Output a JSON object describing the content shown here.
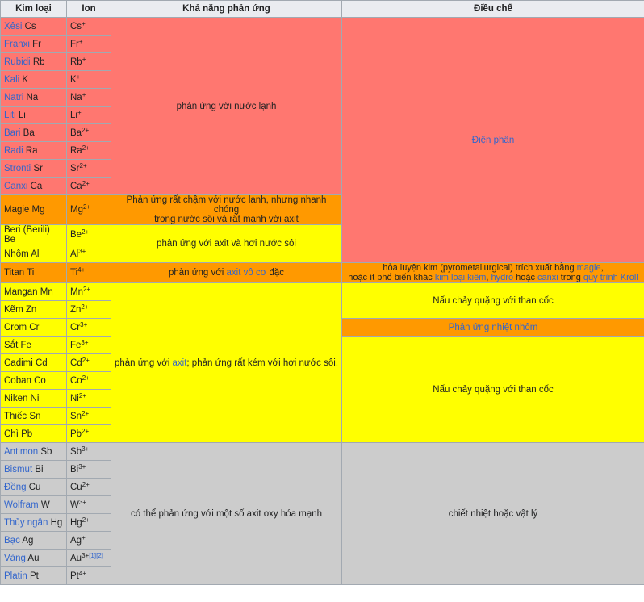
{
  "headers": {
    "metal": "Kim loại",
    "ion": "Ion",
    "reactivity": "Khả năng phản ứng",
    "extraction": "Điều chế"
  },
  "colors": {
    "red": "#ff7770",
    "orange": "#ff9900",
    "yellow": "#ffff00",
    "gray": "#cccccc",
    "link": "#3366cc"
  },
  "rows": [
    {
      "link": "Xêsi",
      "symbol": "Cs",
      "ion_base": "Cs",
      "ion_sup": "+"
    },
    {
      "link": "Franxi",
      "symbol": "Fr",
      "ion_base": "Fr",
      "ion_sup": "+"
    },
    {
      "link": "Rubidi",
      "symbol": "Rb",
      "ion_base": "Rb",
      "ion_sup": "+"
    },
    {
      "link": "Kali",
      "symbol": "K",
      "ion_base": "K",
      "ion_sup": "+"
    },
    {
      "link": "Natri",
      "symbol": "Na",
      "ion_base": "Na",
      "ion_sup": "+"
    },
    {
      "link": "Liti",
      "symbol": "Li",
      "ion_base": "Li",
      "ion_sup": "+"
    },
    {
      "link": "Bari",
      "symbol": "Ba",
      "ion_base": "Ba",
      "ion_sup": "2+"
    },
    {
      "link": "Radi",
      "symbol": "Ra",
      "ion_base": "Ra",
      "ion_sup": "2+"
    },
    {
      "link": "Stronti",
      "symbol": "Sr",
      "ion_base": "Sr",
      "ion_sup": "2+"
    },
    {
      "link": "Canxi",
      "symbol": "Ca",
      "ion_base": "Ca",
      "ion_sup": "2+"
    },
    {
      "text": "Magie Mg",
      "ion_base": "Mg",
      "ion_sup": "2+"
    },
    {
      "text": "Beri (Berili) Be",
      "ion_base": "Be",
      "ion_sup": "2+"
    },
    {
      "text": "Nhôm Al",
      "ion_base": "Al",
      "ion_sup": "3+"
    },
    {
      "text": "Titan Ti",
      "ion_base": "Ti",
      "ion_sup": "4+"
    },
    {
      "text": "Mangan Mn",
      "ion_base": "Mn",
      "ion_sup": "2+"
    },
    {
      "text": "Kẽm Zn",
      "ion_base": "Zn",
      "ion_sup": "2+"
    },
    {
      "text": "Crom Cr",
      "ion_base": "Cr",
      "ion_sup": "3+"
    },
    {
      "text": "Sắt Fe",
      "ion_base": "Fe",
      "ion_sup": "3+"
    },
    {
      "text": "Cadimi Cd",
      "ion_base": "Cd",
      "ion_sup": "2+"
    },
    {
      "text": "Coban Co",
      "ion_base": "Co",
      "ion_sup": "2+"
    },
    {
      "text": "Niken Ni",
      "ion_base": "Ni",
      "ion_sup": "2+"
    },
    {
      "text": "Thiếc Sn",
      "ion_base": "Sn",
      "ion_sup": "2+"
    },
    {
      "text": "Chì Pb",
      "ion_base": "Pb",
      "ion_sup": "2+"
    },
    {
      "link": "Antimon",
      "symbol": "Sb",
      "ion_base": "Sb",
      "ion_sup": "3+"
    },
    {
      "link": "Bismut",
      "symbol": "Bi",
      "ion_base": "Bi",
      "ion_sup": "3+"
    },
    {
      "link": "Đồng",
      "symbol": "Cu",
      "ion_base": "Cu",
      "ion_sup": "2+"
    },
    {
      "link": "Wolfram",
      "symbol": "W",
      "ion_base": "W",
      "ion_sup": "3+"
    },
    {
      "link": "Thủy ngân",
      "symbol": "Hg",
      "ion_base": "Hg",
      "ion_sup": "2+"
    },
    {
      "link": "Bạc",
      "symbol": "Ag",
      "ion_base": "Ag",
      "ion_sup": "+"
    },
    {
      "link": "Vàng",
      "symbol": "Au",
      "ion_base": "Au",
      "ion_sup": "3+",
      "refs": "[1][2]"
    },
    {
      "link": "Platin",
      "symbol": "Pt",
      "ion_base": "Pt",
      "ion_sup": "4+"
    }
  ],
  "reactivity": {
    "r1": "phản ứng với nước lạnh",
    "r2_line1": "Phản ứng rất chậm với nước lạnh, nhưng nhanh chóng",
    "r2_line2": "trong nước sôi và rất mạnh với axit",
    "r3": "phản ứng với axit và hơi nước sôi",
    "r4_pre": "phản ứng với ",
    "r4_link": "axit vô cơ",
    "r4_post": " đặc",
    "r5_pre": "phản ứng với ",
    "r5_link": "axit",
    "r5_post": "; phản ứng rất kém với hơi nước sôi.",
    "r6": "có thể phản ứng với một số axit oxy hóa mạnh"
  },
  "extraction": {
    "e1": "Điện phân",
    "e2_line1_pre": "hỏa luyện kim (pyrometallurgical) trích xuất bằng ",
    "e2_line1_link": "magie",
    "e2_line1_post": ",",
    "e2_line2_a": "hoặc ít phổ biến khác ",
    "e2_line2_link1": "kim loại kiềm",
    "e2_line2_b": ", ",
    "e2_line2_link2": "hydro",
    "e2_line2_c": " hoặc ",
    "e2_line2_link3": "canxi",
    "e2_line2_d": " trong ",
    "e2_line2_link4": "quy trình Kroll",
    "e3": "Nấu chảy quặng với than cốc",
    "e4": "Phản ứng nhiệt nhôm",
    "e5": "Nấu chảy quặng với than cốc",
    "e6": "chiết nhiệt hoặc vật lý"
  }
}
